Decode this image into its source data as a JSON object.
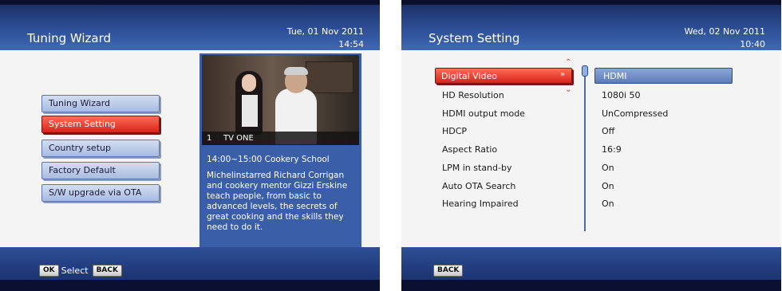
{
  "left_screen": {
    "title": "Tuning Wizard",
    "date": "Tue, 01 Nov 2011",
    "time": "14:54",
    "menu": [
      {
        "label": "Tuning Wizard"
      },
      {
        "label": "System Setting",
        "selected": true
      },
      {
        "label": "Country setup"
      },
      {
        "label": "Factory Default"
      },
      {
        "label": "S/W upgrade via OTA"
      }
    ],
    "preview": {
      "channel_number": "1",
      "channel_name": "TV ONE",
      "programme": "14:00~15:00  Cookery School",
      "description": "Michelinstarred Richard Corrigan and cookery mentor Gizzi Erskine teach people, from basic to advanced levels, the secrets of great cooking and the skills they need to do it."
    },
    "footer": {
      "ok_key": "OK",
      "ok_label": "Select",
      "back_key": "BACK"
    }
  },
  "right_screen": {
    "title": "System Setting",
    "date": "Wed, 02 Nov 2011",
    "time": "10:40",
    "settings": [
      {
        "label": "Digital Video",
        "value": "HDMI",
        "selected": true
      },
      {
        "label": "HD Resolution",
        "value": "1080i 50"
      },
      {
        "label": "HDMI output mode",
        "value": "UnCompressed"
      },
      {
        "label": "HDCP",
        "value": "Off"
      },
      {
        "label": "Aspect Ratio",
        "value": "16:9"
      },
      {
        "label": "LPM in stand-by",
        "value": "On"
      },
      {
        "label": "Auto OTA Search",
        "value": "On"
      },
      {
        "label": "Hearing Impaired",
        "value": "On"
      }
    ],
    "footer": {
      "back_key": "BACK"
    }
  },
  "colors": {
    "header_blue": "#2c4d94",
    "selection_red": "#d8231a",
    "panel_bg": "#f4f4f4",
    "preview_blue": "#3a5ea8"
  }
}
